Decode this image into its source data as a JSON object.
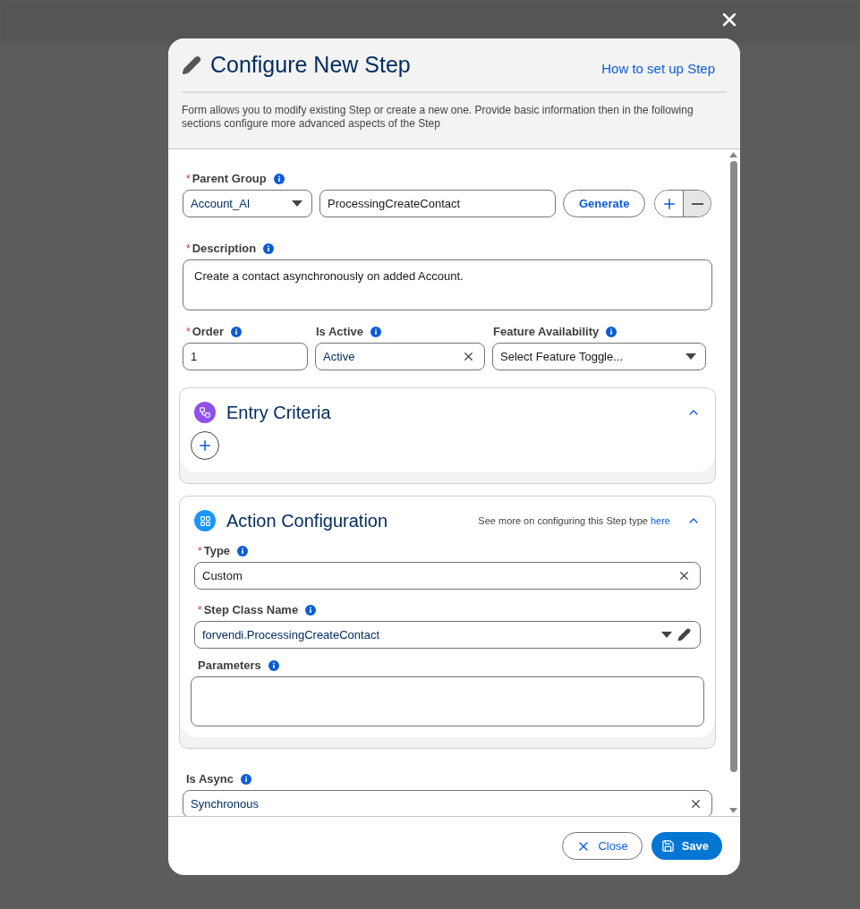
{
  "dialog": {
    "title": "Configure New Step",
    "help_link": "How to set up Step",
    "description": "Form allows you to modify existing Step or create a new one. Provide basic information then in the following sections configure more advanced aspects of the Step"
  },
  "parent_group": {
    "label": "Parent Group",
    "required_mark": "*",
    "select_value": "Account_AI",
    "name_value": "ProcessingCreateContact",
    "generate_button": "Generate"
  },
  "description_field": {
    "label": "Description",
    "required_mark": "*",
    "value": "Create a contact asynchronously on added Account."
  },
  "order_field": {
    "label": "Order",
    "required_mark": "*",
    "value": "1"
  },
  "is_active_field": {
    "label": "Is Active",
    "value": "Active"
  },
  "feature_field": {
    "label": "Feature Availability",
    "placeholder": "Select Feature Toggle..."
  },
  "entry_criteria": {
    "title": "Entry Criteria",
    "expanded": true
  },
  "action_configuration": {
    "title": "Action Configuration",
    "expanded": true,
    "hint": "See more on configuring this Step type",
    "hint_link": "here",
    "type_field": {
      "label": "Type",
      "required_mark": "*",
      "value": "Custom"
    },
    "class_field": {
      "label": "Step Class Name",
      "required_mark": "*",
      "value": "forvendi.ProcessingCreateContact"
    },
    "parameters_field": {
      "label": "Parameters"
    }
  },
  "is_async_field": {
    "label": "Is Async",
    "value": "Synchronous"
  },
  "footer": {
    "close_button": "Close",
    "save_button": "Save"
  }
}
